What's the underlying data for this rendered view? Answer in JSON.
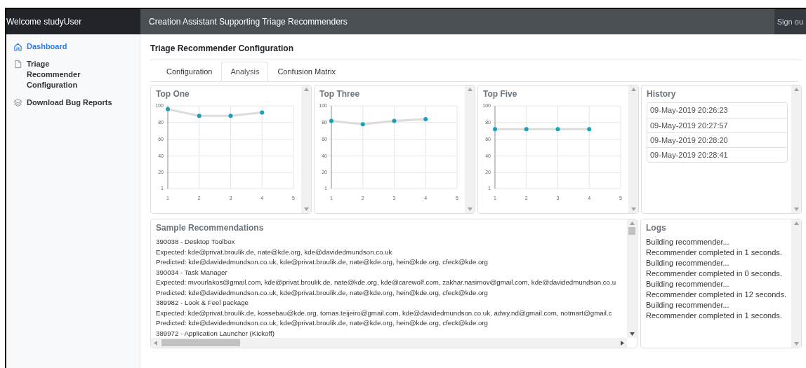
{
  "header": {
    "welcome": "Welcome studyUser",
    "app_title": "Creation Assistant Supporting Triage Recommenders",
    "sign_out": "Sign ou"
  },
  "sidebar": {
    "items": [
      {
        "label": "Dashboard",
        "selected": true
      },
      {
        "label": "Triage Recommender Configuration",
        "selected": false
      },
      {
        "label": "Download Bug Reports",
        "selected": false
      }
    ]
  },
  "page_title": "Triage Recommender Configuration",
  "tabs": [
    {
      "label": "Configuration",
      "selected": false
    },
    {
      "label": "Analysis",
      "selected": true
    },
    {
      "label": "Confusion Matrix",
      "selected": false
    }
  ],
  "charts": [
    {
      "title": "Top One",
      "chart_data": {
        "type": "line",
        "grid": true,
        "x": [
          1,
          2,
          3,
          4
        ],
        "series": [
          {
            "color": "#17a2b8",
            "marker": "circle",
            "values": [
              96,
              88,
              88,
              92
            ]
          }
        ],
        "xlim": [
          1,
          5
        ],
        "ylim": [
          1,
          100
        ],
        "xticks": [
          1,
          2,
          3,
          4,
          5
        ],
        "yticks": [
          1,
          20,
          40,
          60,
          80,
          100
        ]
      }
    },
    {
      "title": "Top Three",
      "chart_data": {
        "type": "line",
        "grid": true,
        "x": [
          1,
          2,
          3,
          4
        ],
        "series": [
          {
            "color": "#17a2b8",
            "marker": "circle",
            "values": [
              82,
              78,
              82,
              84
            ]
          }
        ],
        "xlim": [
          1,
          5
        ],
        "ylim": [
          1,
          100
        ],
        "xticks": [
          1,
          2,
          3,
          4,
          5
        ],
        "yticks": [
          1,
          20,
          40,
          60,
          80,
          100
        ]
      }
    },
    {
      "title": "Top Five",
      "chart_data": {
        "type": "line",
        "grid": true,
        "x": [
          1,
          2,
          3,
          4
        ],
        "series": [
          {
            "color": "#17a2b8",
            "marker": "circle",
            "values": [
              72,
              72,
              72,
              72
            ]
          }
        ],
        "xlim": [
          1,
          5
        ],
        "ylim": [
          1,
          100
        ],
        "xticks": [
          1,
          2,
          3,
          4,
          5
        ],
        "yticks": [
          1,
          20,
          40,
          60,
          80,
          100
        ]
      }
    }
  ],
  "history": {
    "title": "History",
    "items": [
      "09-May-2019 20:26:23",
      "09-May-2019 20:27:57",
      "09-May-2019 20:28:20",
      "09-May-2019 20:28:41"
    ]
  },
  "samples": {
    "title": "Sample Recommendations",
    "lines": [
      "390038 - Desktop Toolbox",
      "Expected: kde@privat.broulik.de, nate@kde.org, kde@davidedmundson.co.uk",
      "Predicted: kde@davidedmundson.co.uk, kde@privat.broulik.de, nate@kde.org, hein@kde.org, cfeck@kde.org",
      "390034 - Task Manager",
      "Expected: mvourlakos@gmail.com, kde@privat.broulik.de, nate@kde.org, kde@carewolf.com, zakhar.nasimov@gmail.com, kde@davidedmundson.co.u",
      "Predicted: kde@davidedmundson.co.uk, kde@privat.broulik.de, nate@kde.org, hein@kde.org, cfeck@kde.org",
      "389982 - Look & Feel package",
      "Expected: kde@privat.broulik.de, kossebau@kde.org, tomas.teijeiro@gmail.com, kde@davidedmundson.co.uk, adwy.nd@gmail.com, notmart@gmail.c",
      "Predicted: kde@davidedmundson.co.uk, kde@privat.broulik.de, nate@kde.org, hein@kde.org, cfeck@kde.org",
      "389972 - Application Launcher (Kickoff)"
    ]
  },
  "logs": {
    "title": "Logs",
    "lines": [
      "Building recommender...",
      "Recommender completed in 1 seconds.",
      "Building recommender...",
      "Recommender completed in 0 seconds.",
      "Building recommender...",
      "Recommender completed in 12 seconds.",
      "Building recommender...",
      "Recommender completed in 1 seconds."
    ]
  }
}
